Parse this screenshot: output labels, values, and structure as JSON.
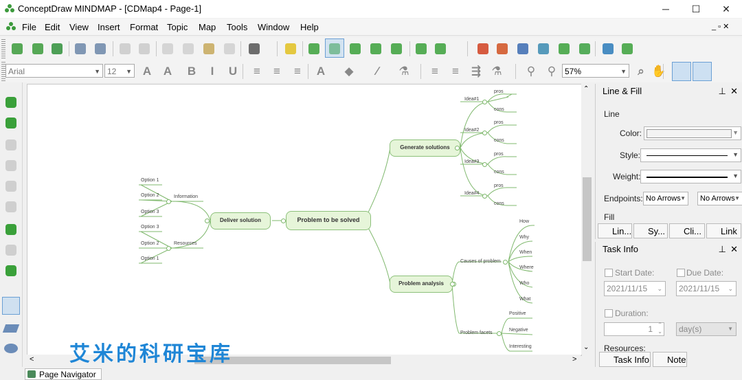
{
  "window": {
    "title": "ConceptDraw MINDMAP - [CDMap4 - Page-1]"
  },
  "menu": {
    "items": [
      "File",
      "Edit",
      "View",
      "Insert",
      "Format",
      "Topic",
      "Map",
      "Tools",
      "Window",
      "Help"
    ],
    "accel": [
      "F",
      "E",
      "V",
      "I",
      "o",
      "T",
      "M",
      "o",
      "W",
      "H"
    ]
  },
  "format_toolbar": {
    "font": "Arial",
    "size": "12",
    "zoom": "57%"
  },
  "line_fill_panel": {
    "title": "Line & Fill",
    "line_section": "Line",
    "color_label": "Color:",
    "style_label": "Style:",
    "weight_label": "Weight:",
    "endpoints_label": "Endpoints:",
    "endpoint_start": "No Arrows",
    "endpoint_end": "No Arrows",
    "fill_section": "Fill",
    "tabs": [
      "Lin...",
      "Sy...",
      "Cli...",
      "Link"
    ]
  },
  "task_panel": {
    "title": "Task Info",
    "start_label": "Start Date:",
    "due_label": "Due Date:",
    "start_value": "2021/11/15",
    "due_value": "2021/11/15",
    "duration_label": "Duration:",
    "duration_value": "1",
    "duration_unit": "day(s)",
    "resources_label": "Resources:",
    "tabs": [
      "Task Info",
      "Note"
    ]
  },
  "page_navigator": "Page Navigator",
  "watermark": "艾米的科研宝库",
  "mindmap": {
    "central": "Problem to be solved",
    "generate": "Generate solutions",
    "deliver": "Deliver solution",
    "analysis": "Problem analysis",
    "ideas": [
      "Idea#1",
      "Idea#2",
      "Idea#3",
      "Idea#4"
    ],
    "pros": "pros",
    "cons": "cons",
    "information": "Information",
    "resources": "Resources",
    "info_options": [
      "Option 1",
      "Option 2",
      "Option 3"
    ],
    "res_options": [
      "Option 3",
      "Option 2",
      "Option 1"
    ],
    "causes": "Causes of problem",
    "causes_items": [
      "How",
      "Why",
      "When",
      "Where",
      "Who",
      "What"
    ],
    "facets": "Problem facets",
    "facets_items": [
      "Positive",
      "Negative",
      "Interesting"
    ]
  },
  "colors": {
    "accent": "#2a7ab8",
    "node_fill": "#e6f5d9",
    "node_border": "#8cc07a",
    "link": "#7fb86d",
    "watermark": "#1f86d6"
  }
}
